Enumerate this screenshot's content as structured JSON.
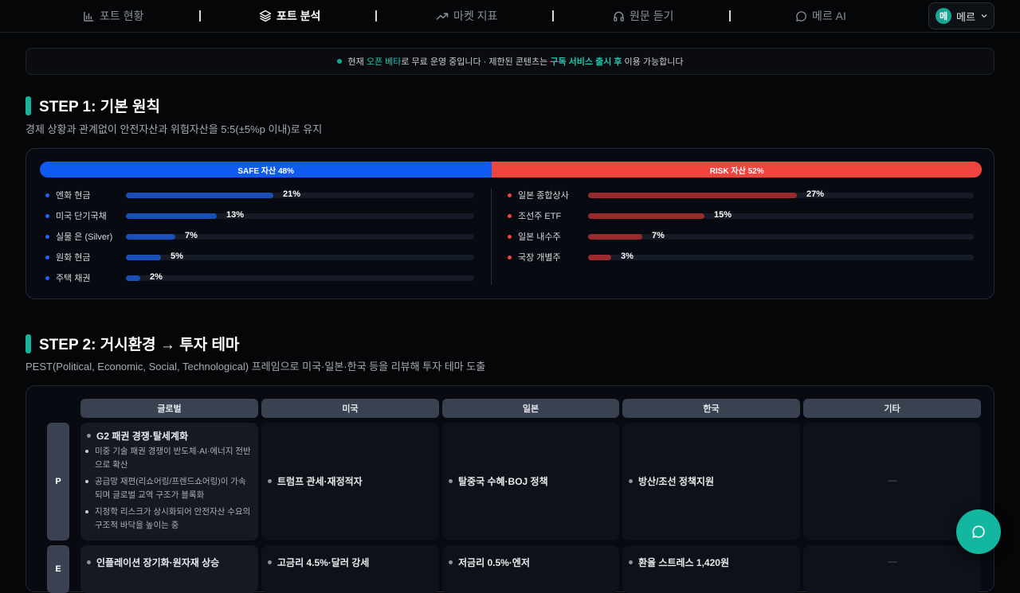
{
  "nav": {
    "items": [
      {
        "label": "포트 현황",
        "icon": "bar-chart-icon"
      },
      {
        "label": "포트 분석",
        "icon": "layers-icon"
      },
      {
        "label": "마켓 지표",
        "icon": "trend-up-icon"
      },
      {
        "label": "원문 듣기",
        "icon": "headphones-icon"
      },
      {
        "label": "메르 AI",
        "icon": "chat-bubble-icon"
      }
    ],
    "user": {
      "avatar": "메",
      "name": "메르"
    }
  },
  "notice": {
    "prefix": "현재 ",
    "highlight1": "오픈 베타",
    "middle": "로 무료 운영 중입니다 · 제한된 콘텐츠는 ",
    "highlight2": "구독 서비스 출시 후",
    "suffix": " 이용 가능합니다"
  },
  "step1": {
    "title": "STEP 1: 기본 원칙",
    "subtitle": "경제 상황과 관계없이 안전자산과 위험자산을 5:5(±5%p 이내)로 유지",
    "safe_label": "SAFE 자산 48%",
    "risk_label": "RISK 자산 52%",
    "safe_share": 48,
    "risk_share": 52,
    "safe_color": "#0f5bf0",
    "risk_color": "#f0453f",
    "safe_items": [
      {
        "label": "엔화 현금",
        "pct": "21%",
        "value": 21
      },
      {
        "label": "미국 단기국채",
        "pct": "13%",
        "value": 13
      },
      {
        "label": "실물 은 (Silver)",
        "pct": "7%",
        "value": 7
      },
      {
        "label": "원화 현금",
        "pct": "5%",
        "value": 5
      },
      {
        "label": "주택 채권",
        "pct": "2%",
        "value": 2
      }
    ],
    "risk_items": [
      {
        "label": "일본 종합상사",
        "pct": "27%",
        "value": 27
      },
      {
        "label": "조선주 ETF",
        "pct": "15%",
        "value": 15
      },
      {
        "label": "일본 내수주",
        "pct": "7%",
        "value": 7
      },
      {
        "label": "국장 개별주",
        "pct": "3%",
        "value": 3
      }
    ]
  },
  "step2": {
    "title": "STEP 2: 거시환경 → 투자 테마",
    "subtitle": "PEST(Political, Economic, Social, Technological) 프레임으로 미국·일본·한국 등을 리뷰해 투자 테마 도출",
    "columns": [
      "글로벌",
      "미국",
      "일본",
      "한국",
      "기타"
    ],
    "rows": [
      {
        "tag": "P",
        "global_title": "G2 패권 경쟁·탈세계화",
        "global_points": [
          "미중 기술 패권 경쟁이 반도체·AI·에너지 전반으로 확산",
          "공급망 재편(리쇼어링/프렌드쇼어링)이 가속되며 글로벌 교역 구조가 블록화",
          "지정학 리스크가 상시화되어 안전자산 수요의 구조적 바닥을 높이는 중"
        ],
        "us": "트럼프 관세·재정적자",
        "jp": "탈중국 수혜·BOJ 정책",
        "kr": "방산/조선 정책지원",
        "etc": "—"
      },
      {
        "tag": "E",
        "global_title": "인플레이션 장기화·원자재 상승",
        "us": "고금리 4.5%·달러 강세",
        "jp": "저금리 0.5%·엔저",
        "kr": "환율 스트레스 1,420원",
        "etc": "—"
      }
    ]
  }
}
